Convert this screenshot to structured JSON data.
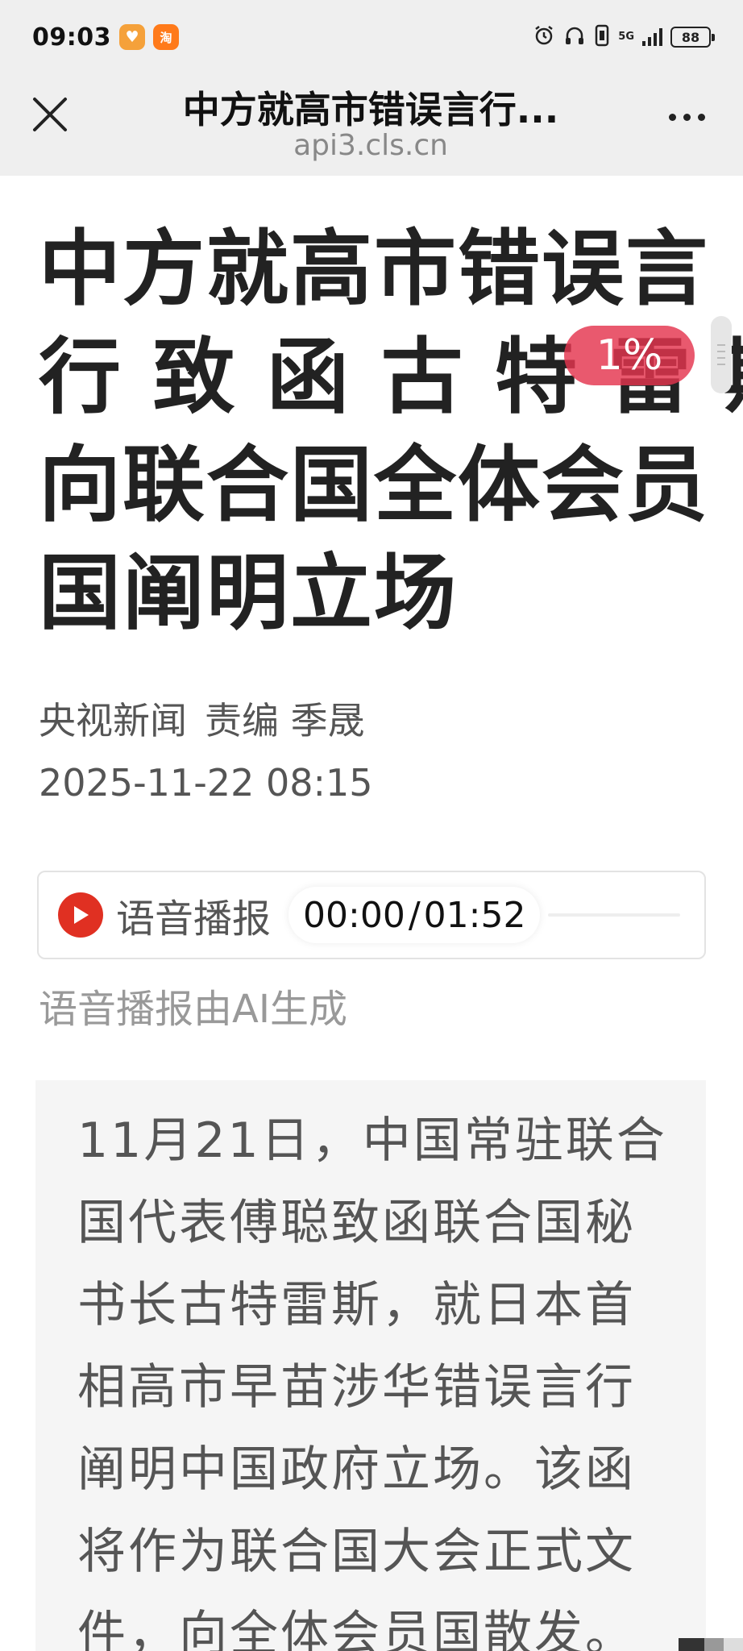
{
  "status_bar": {
    "time": "09:03",
    "app_icons": [
      "heart-app-icon",
      "taobao-app-icon"
    ],
    "taobao_label": "淘",
    "network": "5G",
    "battery": "88"
  },
  "title_bar": {
    "title": "中方就高市错误言行...",
    "url": "api3.cls.cn"
  },
  "article": {
    "headline_lines": [
      "中方就高市错误言",
      "行 致 函 古 特 雷 斯",
      "向联合国全体会员",
      "国阐明立场"
    ],
    "reading_progress": "1%",
    "source": "央视新闻",
    "editor": "责编 季晟",
    "datetime": "2025-11-22 08:15"
  },
  "audio": {
    "label": "语音播报",
    "current_time": "00:00",
    "separator": "/",
    "duration": "01:52",
    "progress": 0,
    "note": "语音播报由AI生成"
  },
  "summary": {
    "lines": [
      "11月21日，中国常驻联合",
      "国代表傅聪致函联合国秘",
      "书长古特雷斯，就日本首",
      "相高市早苗涉华错误言行",
      "阐明中国政府立场。该函",
      "将作为联合国大会正式文",
      "件，向全体会员国散发。"
    ]
  },
  "colors": {
    "bar_background": "#efefef",
    "progress_badge": "#e4344e",
    "play_button": "#e03022",
    "summary_background": "#f5f5f5"
  }
}
